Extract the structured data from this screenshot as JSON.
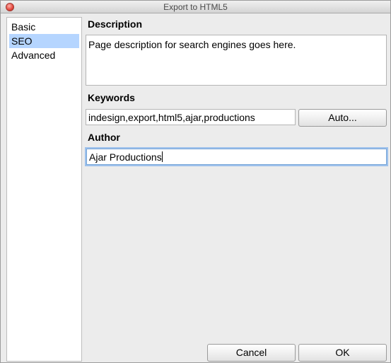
{
  "window": {
    "title": "Export to HTML5"
  },
  "sidebar": {
    "items": [
      {
        "label": "Basic"
      },
      {
        "label": "SEO"
      },
      {
        "label": "Advanced"
      }
    ],
    "selected": "SEO",
    "selected_color": "#b5d5ff"
  },
  "form": {
    "description": {
      "label": "Description",
      "value": "Page description for search engines goes here."
    },
    "keywords": {
      "label": "Keywords",
      "value": "indesign,export,html5,ajar,productions",
      "auto_button": "Auto..."
    },
    "author": {
      "label": "Author",
      "value": "Ajar Productions"
    }
  },
  "footer": {
    "cancel_label": "Cancel",
    "ok_label": "OK"
  }
}
